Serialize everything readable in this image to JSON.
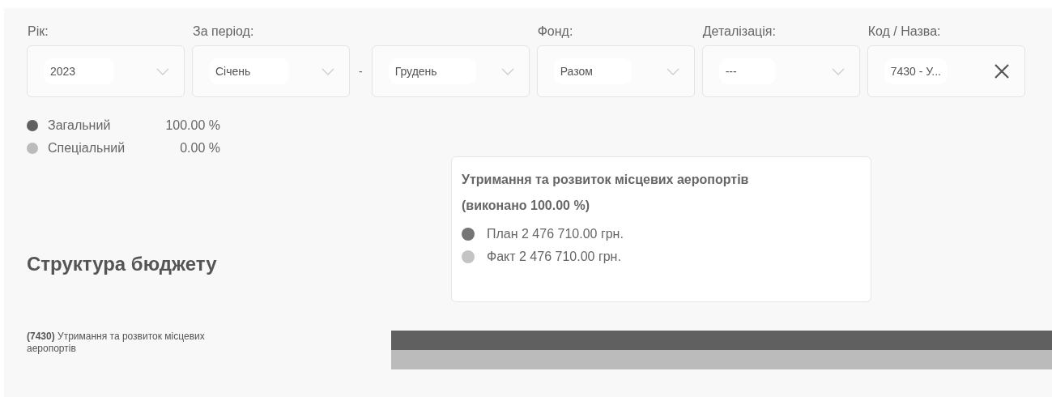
{
  "filters": [
    {
      "label": "Рік:",
      "value": "2023",
      "kind": "select"
    },
    {
      "label": "За період:",
      "value": "Січень",
      "kind": "select"
    },
    {
      "separator": "-"
    },
    {
      "value": "Грудень",
      "kind": "select"
    },
    {
      "label": "Фонд:",
      "value": "Разом",
      "kind": "select"
    },
    {
      "label": "Деталізація:",
      "value": "---",
      "kind": "select"
    },
    {
      "label": "Код / Назва:",
      "value": "7430 - У...",
      "kind": "clearable"
    }
  ],
  "legend": [
    {
      "name": "Загальний",
      "value": "100.00 %",
      "color": "#606060"
    },
    {
      "name": "Спеціальний",
      "value": "0.00 %",
      "color": "#bbbbbb"
    }
  ],
  "title": "Структура бюджету",
  "rows": [
    {
      "code": "(7430)",
      "name": "Утримання та розвиток місцевих аеропортів",
      "bars": [
        {
          "color": "#606060"
        },
        {
          "color": "#bbbbbb"
        }
      ]
    }
  ],
  "tooltip": {
    "title": "Утримання та розвиток місцевих аеропортів (виконано 100.00 %)",
    "items": [
      {
        "text": "План 2 476 710.00 грн.",
        "color": "#757575"
      },
      {
        "text": "Факт 2 476 710.00 грн.",
        "color": "#c4c4c4"
      }
    ]
  }
}
